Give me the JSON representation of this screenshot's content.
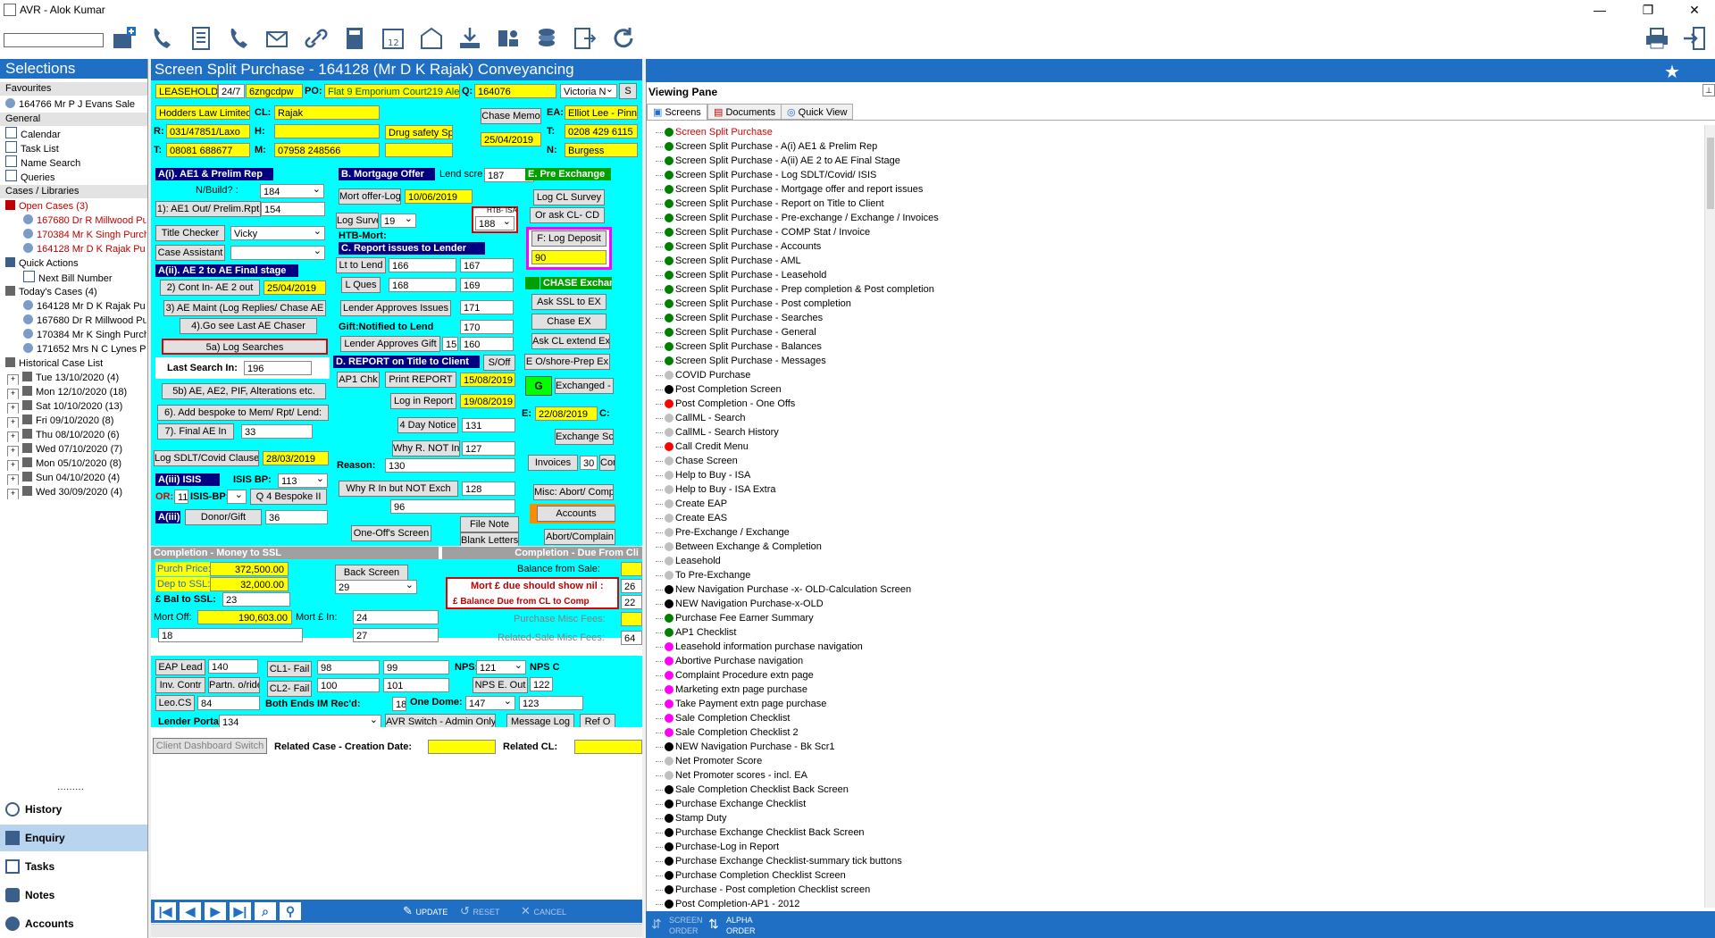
{
  "window": {
    "title": "AVR - Alok Kumar"
  },
  "left": {
    "header": "Selections",
    "favourites_label": "Favourites",
    "favourites": [
      "164766 Mr P J Evans Sale"
    ],
    "general_label": "General",
    "general": [
      "Calendar",
      "Task List",
      "Name Search",
      "Queries"
    ],
    "cases_label": "Cases / Libraries",
    "open_cases": "Open Cases  (3)",
    "open_items": [
      "167680 Dr R Millwood Pu",
      "170384 Mr K Singh Purch",
      "164128 Mr D K Rajak Pu"
    ],
    "quick_actions": "Quick Actions",
    "next_bill": "Next Bill Number",
    "todays_cases": "Today's Cases  (4)",
    "today_items": [
      "164128 Mr D K Rajak Pu",
      "167680 Dr R Millwood Pu",
      "170384 Mr K Singh Purch",
      "171652 Mrs N C Lynes Pu"
    ],
    "historical": "Historical Case List",
    "hist_items": [
      "Tue 13/10/2020  (4)",
      "Mon 12/10/2020  (18)",
      "Sat 10/10/2020  (13)",
      "Fri 09/10/2020  (8)",
      "Thu 08/10/2020  (6)",
      "Wed 07/10/2020  (7)",
      "Mon 05/10/2020  (8)",
      "Sun 04/10/2020  (4)",
      "Wed 30/09/2020  (4)"
    ],
    "nav": [
      "History",
      "Enquiry",
      "Tasks",
      "Notes",
      "Accounts"
    ]
  },
  "form": {
    "title": "Screen Split Purchase - 164128 (Mr D K Rajak) Conveyancing",
    "tenure": "LEASEHOLD",
    "tenure_hrs": "24/7",
    "ref": "6zngcdpw",
    "po_label": "PO:",
    "po": "Flat 9 Emporium Court219 Alexa",
    "q_label": "Q:",
    "q": "164076",
    "agent_sel": "Victoria N",
    "s_btn": "S",
    "firm": "Hodders Law Limited",
    "cl_label": "CL:",
    "cl": "Rajak",
    "drug_label": "Drug safety Spe",
    "chase_memo": "Chase Memo",
    "ea_label": "EA:",
    "ea": "Elliot Lee - Pinne",
    "r_label": "R:",
    "r": "031/47851/Laxo",
    "h_label": "H:",
    "t_label": "T:",
    "t_left": "08081 688677",
    "t_right": "0208 429 6115",
    "m_label": "M:",
    "m": "07958 248566",
    "chase_date": "25/04/2019",
    "n_label": "N:",
    "n": "Burgess",
    "ai_header": "A(i). AE1 & Prelim Rep",
    "nbuild_label": "N/Build? :",
    "nbuild": "184",
    "ae1_out": "1): AE1 Out/ Prelim.Rpt",
    "ae1_out_val": "154",
    "title_checker": "Title Checker",
    "title_checker_val": "Vicky",
    "case_assistant": "Case Assistant",
    "aii_header": "A(ii).  AE 2 to AE Final stage",
    "cont_in": "2) Cont In- AE 2 out",
    "cont_in_date": "25/04/2019",
    "ae_maint": "3) AE Maint (Log Replies/ Chase AE",
    "go_see": "4).Go see Last AE Chaser",
    "log_searches": "5a) Log Searches",
    "last_search_label": "Last Search In:",
    "last_search": "196",
    "ae_ae2": "5b) AE, AE2, PIF, Alterations etc.",
    "add_bespoke": "6). Add bespoke to Mem/ Rpt/ Lend:",
    "final_ae": "7). Final AE In",
    "final_ae_val": "33",
    "log_sdlt": "Log SDLT/Covid Clause",
    "log_sdlt_date": "28/03/2019",
    "aiii_isis": "A(iii) ISIS",
    "isis_bp_label": "ISIS BP:",
    "isis_bp": "113",
    "or_label": "OR:",
    "or_val": "11",
    "isis_bp2": "ISIS-BP:",
    "q4_bespoke": "Q 4 Bespoke II",
    "aiii2": "A(iii)",
    "donor_gift": "Donor/Gift",
    "donor_val": "36",
    "b_header": "B. Mortgage Offer",
    "lend_scre": "Lend scre",
    "lend_scre_val": "187",
    "mort_offer_log": "Mort offer-Log",
    "mort_offer_date": "10/06/2019",
    "log_survey": "Log Survey",
    "log_survey_val": "19",
    "htb_isa": "HTB- ISA",
    "htb_val": "188",
    "htb_mort": "HTB-Mort:",
    "c_header": "C. Report issues to Lender",
    "lt_to_lend": "Lt to Lend",
    "lt_a": "166",
    "lt_b": "167",
    "l_ques": "L Ques",
    "lq_a": "168",
    "lq_b": "169",
    "lender_approves": "Lender Approves Issues",
    "lender_approves_val": "171",
    "gift_notified": "Gift:Notified to Lend",
    "gift_val": "170",
    "lender_approves_gift": "Lender Approves Gift",
    "lag_a": "15",
    "lag_b": "160",
    "d_header": "D. REPORT on Title  to Client",
    "s_off": "S/Off",
    "ap1_chk": "AP1 Chk",
    "print_report": "Print REPORT",
    "print_date": "15/08/2019",
    "log_in_report": "Log in Report",
    "log_in_date": "19/08/2019",
    "four_day": "4 Day Notice",
    "four_day_val": "131",
    "why_r_not": "Why R. NOT In",
    "why_val": "127",
    "reason_label": "Reason:",
    "reason": "130",
    "why_r_in": "Why R In but NOT Exch",
    "why_in_val": "128",
    "why_in_val2": "96",
    "one_offs": "One-Off's Screen",
    "file_note": "File Note",
    "blank_letters": "Blank Letters",
    "e_header": "E. Pre Exchange",
    "log_cl_survey": "Log CL Survey",
    "or_ask": "Or ask CL- CD",
    "f_log_deposit": "F: Log Deposit",
    "deposit_val": "90",
    "chase_exch": "CHASE Exchan",
    "ask_ssl": "Ask SSL to EX",
    "chase_ex": "Chase EX",
    "ask_cl_extend": "Ask CL extend Ex",
    "e_o_shore": "E O/shore-Prep Ex",
    "g_label": "G",
    "exchanged": "Exchanged - N",
    "e_label": "E:",
    "e_date": "22/08/2019",
    "c_label2": "C:",
    "exchange_sc": "Exchange Sc",
    "invoices": "Invoices",
    "invoices_val": "30",
    "com": "Com",
    "misc_abort": "Misc: Abort/ Complai",
    "accounts_btn": "Accounts",
    "abort_complain": "Abort/Complain",
    "comp_ssl_header": "Completion - Money to SSL",
    "comp_due_header": "Completion - Due From Cli",
    "purch_price_label": "Purch Price:",
    "purch_price": "372,500.00",
    "dep_ssl_label": "Dep to SSL:",
    "dep_ssl": "32,000.00",
    "bal_ssl_label": "£ Bal to SSL:",
    "bal_ssl": "23",
    "back_screen": "Back Screen",
    "back_val": "29",
    "bal_from_sale": "Balance from Sale:",
    "mort_due_nil": "Mort £ due should show nil :",
    "mort_due_val": "26",
    "bal_due_cl": "£ Balance Due from CL to Comp",
    "bal_due_val": "22",
    "mort_off_label": "Mort Off:",
    "mort_off": "190,603.00",
    "mort_in_label": "Mort £ In:",
    "mort_in": "24",
    "purch_misc": "Purchase Misc Fees:",
    "val_18": "18",
    "val_27": "27",
    "related_sale": "Related-Sale Misc Fees:",
    "related_sale_val": "64",
    "eap_lead": "EAP Lead",
    "eap_val": "140",
    "cl1_fail": "CL1- Fail",
    "cl1_a": "98",
    "cl1_b": "99",
    "nps_label": "NPS:",
    "nps": "121",
    "nps_c": "NPS C",
    "inv_contr": "Inv. Contr",
    "partn": "Partn. o/ride",
    "cl2_fail": "CL2- Fail",
    "cl2_a": "100",
    "cl2_b": "101",
    "nps_e_out": "NPS E. Out",
    "nps_e_val": "122",
    "leo_cs": "Leo.CS",
    "leo_val": "84",
    "both_ends": "Both Ends IM Rec'd:",
    "both_val": "18",
    "one_dome": "One Dome:",
    "one_dome_val": "147",
    "val_123": "123",
    "lender_portal": "Lender Portal:",
    "lender_portal_val": "134",
    "avr_switch": "AVR Switch - Admin Only",
    "message_log": "Message Log",
    "ref_o": "Ref O",
    "client_dash": "Client Dashboard Switch",
    "related_case_label": "Related Case - Creation Date:",
    "related_cl_label": "Related CL:",
    "update": "UPDATE",
    "reset": "RESET",
    "cancel": "CANCEL"
  },
  "viewing": {
    "title": "Viewing Pane",
    "tabs": [
      "Screens",
      "Documents",
      "Quick View"
    ],
    "items": [
      {
        "t": "Screen Split Purchase",
        "c": "#008000",
        "red": true
      },
      {
        "t": "Screen Split Purchase - A(i) AE1 & Prelim Rep",
        "c": "#008000"
      },
      {
        "t": "Screen Split Purchase - A(ii) AE 2 to AE Final Stage",
        "c": "#008000"
      },
      {
        "t": "Screen Split Purchase - Log SDLT/Covid/ ISIS",
        "c": "#008000"
      },
      {
        "t": "Screen Split Purchase - Mortgage offer and report issues",
        "c": "#008000"
      },
      {
        "t": "Screen Split Purchase - Report on Title to Client",
        "c": "#008000"
      },
      {
        "t": "Screen Split Purchase - Pre-exchange / Exchange / Invoices",
        "c": "#008000"
      },
      {
        "t": "Screen Split Purchase - COMP Stat / Invoice",
        "c": "#008000"
      },
      {
        "t": "Screen Split Purchase - Accounts",
        "c": "#008000"
      },
      {
        "t": "Screen Split Purchase - AML",
        "c": "#008000"
      },
      {
        "t": "Screen Split Purchase - Leasehold",
        "c": "#008000"
      },
      {
        "t": "Screen Split Purchase - Prep completion & Post completion",
        "c": "#008000"
      },
      {
        "t": "Screen Split Purchase - Post completion",
        "c": "#008000"
      },
      {
        "t": "Screen Split Purchase - Searches",
        "c": "#008000"
      },
      {
        "t": "Screen Split Purchase - General",
        "c": "#008000"
      },
      {
        "t": "Screen Split Purchase - Balances",
        "c": "#008000"
      },
      {
        "t": "Screen Split Purchase - Messages",
        "c": "#008000"
      },
      {
        "t": "COVID Purchase",
        "c": "#c0c0c0"
      },
      {
        "t": "Post Completion Screen",
        "c": "#000000"
      },
      {
        "t": "Post Completion - One Offs",
        "c": "#ff0000"
      },
      {
        "t": "CallML - Search",
        "c": "#c0c0c0"
      },
      {
        "t": "CallML - Search History",
        "c": "#c0c0c0"
      },
      {
        "t": "Call Credit Menu",
        "c": "#ff0000"
      },
      {
        "t": "Chase Screen",
        "c": "#c0c0c0"
      },
      {
        "t": "Help to Buy - ISA",
        "c": "#c0c0c0"
      },
      {
        "t": "Help to Buy - ISA Extra",
        "c": "#c0c0c0"
      },
      {
        "t": "Create EAP",
        "c": "#c0c0c0"
      },
      {
        "t": "Create EAS",
        "c": "#c0c0c0"
      },
      {
        "t": "Pre-Exchange / Exchange",
        "c": "#c0c0c0"
      },
      {
        "t": "Between Exchange & Completion",
        "c": "#c0c0c0"
      },
      {
        "t": "Leasehold",
        "c": "#c0c0c0"
      },
      {
        "t": "To Pre-Exchange",
        "c": "#c0c0c0"
      },
      {
        "t": "New Navigation Purchase -x- OLD-Calculation Screen",
        "c": "#000000"
      },
      {
        "t": "NEW Navigation Purchase-x-OLD",
        "c": "#000000"
      },
      {
        "t": "Purchase Fee Earner Summary",
        "c": "#008000"
      },
      {
        "t": "AP1 Checklist",
        "c": "#008000"
      },
      {
        "t": "Leasehold information purchase navigation",
        "c": "#ff00ff"
      },
      {
        "t": "Abortive Purchase navigation",
        "c": "#ff00ff"
      },
      {
        "t": "Complaint Procedure extn page",
        "c": "#ff00ff"
      },
      {
        "t": "Marketing extn page purchase",
        "c": "#ff00ff"
      },
      {
        "t": "Take Payment extn page purchase",
        "c": "#ff00ff"
      },
      {
        "t": "Sale Completion Checklist",
        "c": "#ff00ff"
      },
      {
        "t": "Sale Completion Checklist 2",
        "c": "#ff00ff"
      },
      {
        "t": "NEW Navigation Purchase - Bk Scr1",
        "c": "#000000"
      },
      {
        "t": "Net Promoter Score",
        "c": "#c0c0c0"
      },
      {
        "t": "Net Promoter scores - incl. EA",
        "c": "#c0c0c0"
      },
      {
        "t": "Sale Completion Checklist Back Screen",
        "c": "#000000"
      },
      {
        "t": "Purchase Exchange Checklist",
        "c": "#000000"
      },
      {
        "t": "Stamp Duty",
        "c": "#000000"
      },
      {
        "t": "Purchase Exchange Checklist Back Screen",
        "c": "#000000"
      },
      {
        "t": "Purchase-Log in Report",
        "c": "#000000"
      },
      {
        "t": " Purchase Exchange Checklist-summary tick buttons",
        "c": "#000000"
      },
      {
        "t": "Purchase Completion Checklist Screen",
        "c": "#000000"
      },
      {
        "t": "Purchase - Post completion Checklist screen",
        "c": "#000000"
      },
      {
        "t": "Post Completion-AP1 - 2012",
        "c": "#000000"
      }
    ],
    "screen_order": "SCREEN ORDER",
    "alpha_order": "ALPHA ORDER"
  },
  "colors": {
    "accent": "#1f6fc4",
    "cyan": "#00ffff",
    "yellow": "#ffff00"
  }
}
